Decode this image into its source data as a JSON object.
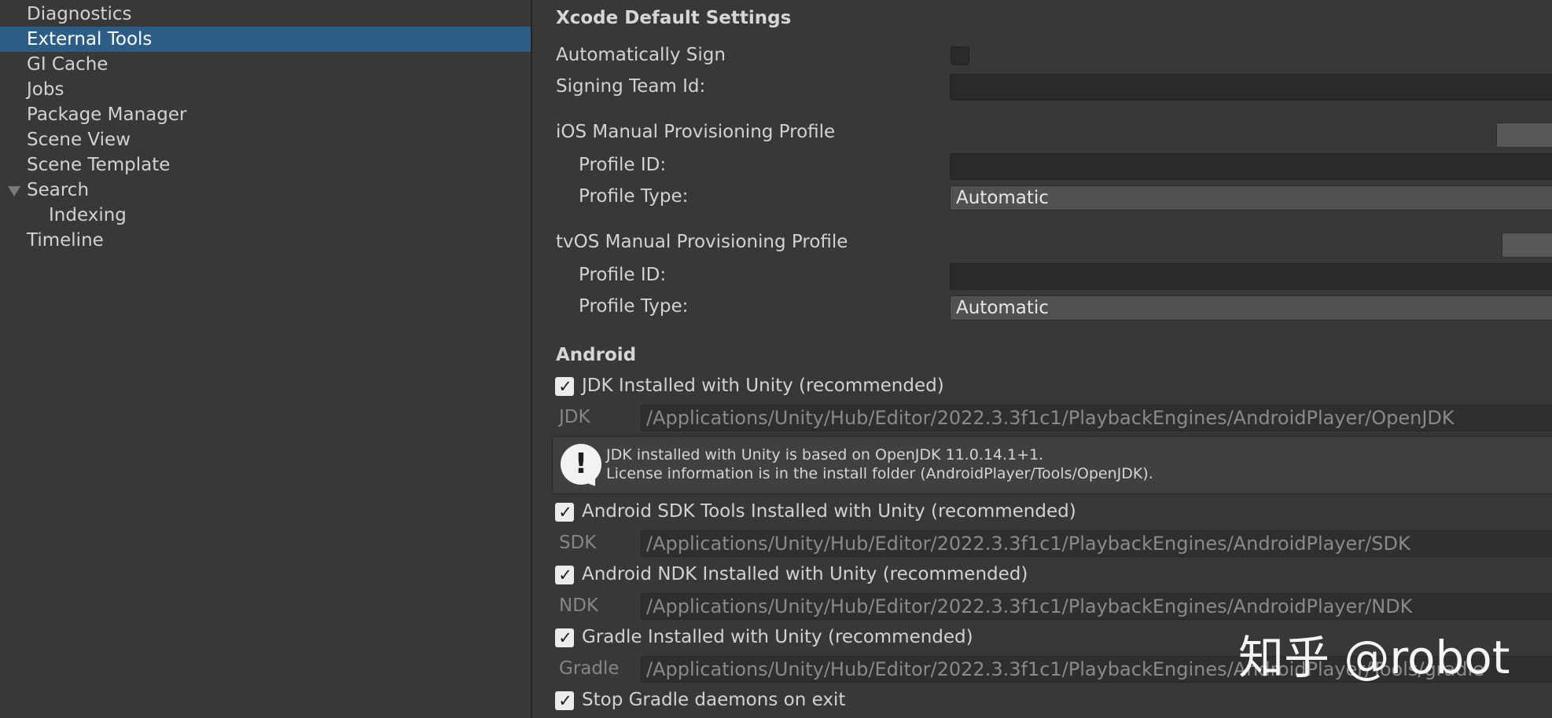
{
  "sidebar": {
    "items": [
      {
        "label": "Diagnostics"
      },
      {
        "label": "External Tools"
      },
      {
        "label": "GI Cache"
      },
      {
        "label": "Jobs"
      },
      {
        "label": "Package Manager"
      },
      {
        "label": "Scene View"
      },
      {
        "label": "Scene Template"
      },
      {
        "label": "Search"
      },
      {
        "label": "Indexing"
      },
      {
        "label": "Timeline"
      }
    ],
    "selected": "External Tools"
  },
  "xcode": {
    "title": "Xcode Default Settings",
    "auto_sign_label": "Automatically Sign",
    "auto_sign_checked": false,
    "signing_team_label": "Signing Team Id:",
    "signing_team_value": "",
    "ios": {
      "title": "iOS Manual Provisioning Profile",
      "profile_id_label": "Profile ID:",
      "profile_id_value": "",
      "profile_type_label": "Profile Type:",
      "profile_type_value": "Automatic"
    },
    "tvos": {
      "title": "tvOS Manual Provisioning Profile",
      "profile_id_label": "Profile ID:",
      "profile_id_value": "",
      "profile_type_label": "Profile Type:",
      "profile_type_value": "Automatic"
    }
  },
  "android": {
    "title": "Android",
    "jdk": {
      "check_label": "JDK Installed with Unity (recommended)",
      "checked": true,
      "path_label": "JDK",
      "path": "/Applications/Unity/Hub/Editor/2022.3.3f1c1/PlaybackEngines/AndroidPlayer/OpenJDK"
    },
    "help": {
      "line1": "JDK installed with Unity is based on OpenJDK 11.0.14.1+1.",
      "line2": "License information is in the install folder (AndroidPlayer/Tools/OpenJDK)."
    },
    "sdk": {
      "check_label": "Android SDK Tools Installed with Unity (recommended)",
      "checked": true,
      "path_label": "SDK",
      "path": "/Applications/Unity/Hub/Editor/2022.3.3f1c1/PlaybackEngines/AndroidPlayer/SDK"
    },
    "ndk": {
      "check_label": "Android NDK Installed with Unity (recommended)",
      "checked": true,
      "path_label": "NDK",
      "path": "/Applications/Unity/Hub/Editor/2022.3.3f1c1/PlaybackEngines/AndroidPlayer/NDK"
    },
    "gradle": {
      "check_label": "Gradle Installed with Unity (recommended)",
      "checked": true,
      "path_label": "Gradle",
      "path": "/Applications/Unity/Hub/Editor/2022.3.3f1c1/PlaybackEngines/AndroidPlayer/Tools/gradle"
    },
    "stop_daemons": {
      "check_label": "Stop Gradle daemons on exit",
      "checked": true
    }
  },
  "watermark": "知乎 @robot",
  "colors": {
    "background": "#383838",
    "selection": "#2c5d87",
    "text": "#d2d2d2"
  }
}
